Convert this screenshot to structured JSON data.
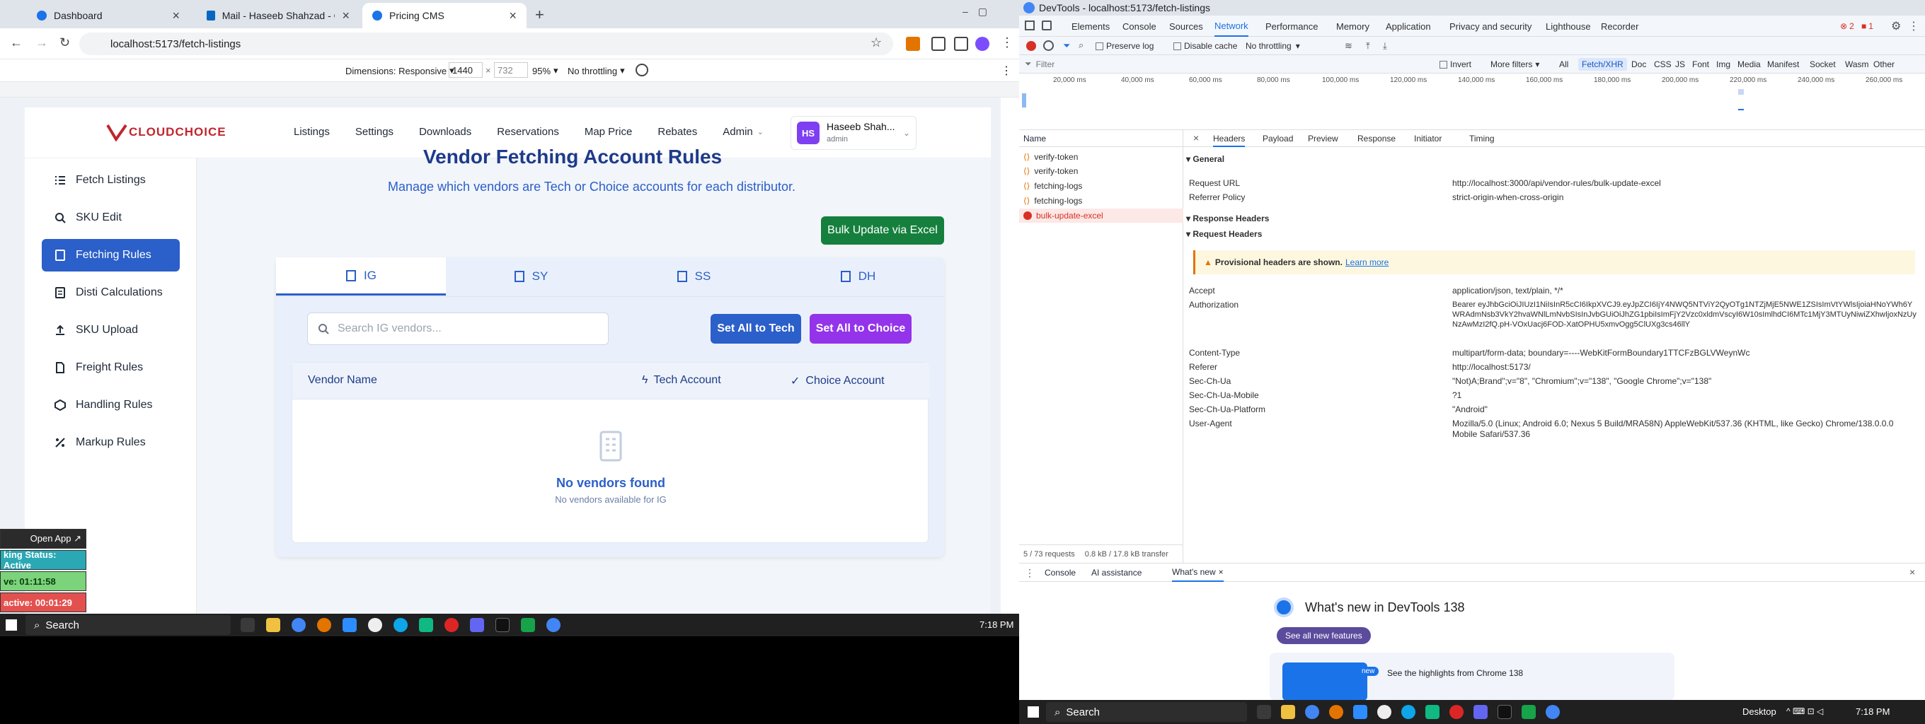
{
  "browser": {
    "tabs": [
      {
        "title": "Dashboard",
        "active": false
      },
      {
        "title": "Mail - Haseeb Shahzad - Outlo",
        "active": false
      },
      {
        "title": "Pricing CMS",
        "active": true
      }
    ],
    "url": "localhost:5173/fetch-listings",
    "device_toolbar": {
      "dimensions_label": "Dimensions: Responsive",
      "width": "1440",
      "height": "732",
      "zoom": "95%",
      "throttle": "No throttling"
    }
  },
  "app": {
    "logo": "CLOUDCHOICE",
    "nav": [
      "Listings",
      "Settings",
      "Downloads",
      "Reservations",
      "Map Price",
      "Rebates",
      "Admin"
    ],
    "user": {
      "initials": "HS",
      "name": "Haseeb Shah...",
      "role": "admin"
    },
    "sidebar": [
      {
        "label": "Fetch Listings",
        "icon": "list-icon",
        "active": false
      },
      {
        "label": "SKU Edit",
        "icon": "search-icon",
        "active": false
      },
      {
        "label": "Fetching Rules",
        "icon": "book-icon",
        "active": true
      },
      {
        "label": "Disti Calculations",
        "icon": "document-icon",
        "active": false
      },
      {
        "label": "SKU Upload",
        "icon": "upload-icon",
        "active": false
      },
      {
        "label": "Freight Rules",
        "icon": "file-icon",
        "active": false
      },
      {
        "label": "Handling Rules",
        "icon": "box-icon",
        "active": false
      },
      {
        "label": "Markup Rules",
        "icon": "percent-icon",
        "active": false
      }
    ],
    "page": {
      "title_partial": "Vendor Fetching Account Rules",
      "subtitle": "Manage which vendors are Tech or Choice accounts for each distributor.",
      "bulk_button": "Bulk Update via Excel",
      "dist_tabs": [
        "IG",
        "SY",
        "SS",
        "DH"
      ],
      "search_placeholder": "Search IG vendors...",
      "set_tech": "Set All to Tech",
      "set_choice": "Set All to Choice",
      "columns": {
        "vendor": "Vendor Name",
        "tech": "Tech Account",
        "choice": "Choice Account"
      },
      "empty_title": "No vendors found",
      "empty_sub": "No vendors available for IG"
    },
    "floating": {
      "open_app": "Open App ↗",
      "status": "king Status: Active",
      "active_time": "ve: 01:11:58",
      "inactive_time": "active: 00:01:29"
    }
  },
  "taskbar_left": {
    "search": "Search",
    "time": "7:18 PM"
  },
  "devtools": {
    "title": "DevTools - localhost:5173/fetch-listings",
    "panels": [
      "Elements",
      "Console",
      "Sources",
      "Network",
      "Performance",
      "Memory",
      "Application",
      "Privacy and security",
      "Lighthouse",
      "Recorder"
    ],
    "active_panel": "Network",
    "errors": "2",
    "warnings": "1",
    "toolbar": {
      "preserve_log": "Preserve log",
      "disable_cache": "Disable cache",
      "throttle": "No throttling"
    },
    "filter": {
      "placeholder": "Filter",
      "invert": "Invert",
      "more_filters": "More filters",
      "types": [
        "All",
        "Fetch/XHR",
        "Doc",
        "CSS",
        "JS",
        "Font",
        "Img",
        "Media",
        "Manifest",
        "Socket",
        "Wasm",
        "Other"
      ],
      "active_type": "Fetch/XHR"
    },
    "timeline_ticks": [
      "20,000 ms",
      "40,000 ms",
      "60,000 ms",
      "80,000 ms",
      "100,000 ms",
      "120,000 ms",
      "140,000 ms",
      "160,000 ms",
      "180,000 ms",
      "200,000 ms",
      "220,000 ms",
      "240,000 ms",
      "260,000 ms"
    ],
    "name_header": "Name",
    "requests": [
      {
        "name": "verify-token",
        "error": false
      },
      {
        "name": "verify-token",
        "error": false
      },
      {
        "name": "fetching-logs",
        "error": false
      },
      {
        "name": "fetching-logs",
        "error": false
      },
      {
        "name": "bulk-update-excel",
        "error": true
      }
    ],
    "summary": "5 / 73 requests",
    "transfer": "0.8 kB / 17.8 kB transfer",
    "detail_tabs": [
      "Headers",
      "Payload",
      "Preview",
      "Response",
      "Initiator",
      "Timing"
    ],
    "general": {
      "section": "General",
      "rows": [
        {
          "k": "Request URL",
          "v": "http://localhost:3000/api/vendor-rules/bulk-update-excel"
        },
        {
          "k": "Referrer Policy",
          "v": "strict-origin-when-cross-origin"
        }
      ]
    },
    "response_headers": "Response Headers",
    "request_headers": {
      "section": "Request Headers",
      "warning": "Provisional headers are shown.",
      "learn_more": "Learn more",
      "rows": [
        {
          "k": "Accept",
          "v": "application/json, text/plain, */*"
        },
        {
          "k": "Authorization",
          "v": "Bearer eyJhbGciOiJIUzI1NiIsInR5cCI6IkpXVCJ9.eyJpZCI6IjY4NWQ5NTViY2QyOTg1NTZjMjE5NWE1ZSIsImVtYWlsIjoiaHNoYWh6YWRAdmNsb3VkY2hvaWNlLmNvbSIsInJvbGUiOiJhZG1pbiIsImFjY2Vzc0xldmVscyI6W10sImlhdCI6MTc1MjY3MTUyNiwiZXhwIjoxNzUyNzAwMzI2fQ.pH-VOxUacj6FOD-XatOPHU5xmvOgg5ClUXg3cs46llY"
        },
        {
          "k": "Content-Type",
          "v": "multipart/form-data; boundary=----WebKitFormBoundary1TTCFzBGLVWeynWc"
        },
        {
          "k": "Referer",
          "v": "http://localhost:5173/"
        },
        {
          "k": "Sec-Ch-Ua",
          "v": "\"Not)A;Brand\";v=\"8\", \"Chromium\";v=\"138\", \"Google Chrome\";v=\"138\""
        },
        {
          "k": "Sec-Ch-Ua-Mobile",
          "v": "?1"
        },
        {
          "k": "Sec-Ch-Ua-Platform",
          "v": "\"Android\""
        },
        {
          "k": "User-Agent",
          "v": "Mozilla/5.0 (Linux; Android 6.0; Nexus 5 Build/MRA58N) AppleWebKit/537.36 (KHTML, like Gecko) Chrome/138.0.0.0 Mobile Safari/537.36"
        }
      ]
    },
    "drawer_tabs": [
      "Console",
      "AI assistance",
      "What's new"
    ],
    "whats_new_title": "What's new in DevTools 138",
    "see_all": "See all new features",
    "new_badge": "new",
    "highlights": "See the highlights from Chrome 138"
  },
  "taskbar_right": {
    "search": "Search",
    "desktop": "Desktop",
    "time": "7:18 PM"
  },
  "colors": {
    "primary": "#2b5fc9",
    "green": "#15803d",
    "purple": "#9333ea",
    "error": "#d93025"
  }
}
